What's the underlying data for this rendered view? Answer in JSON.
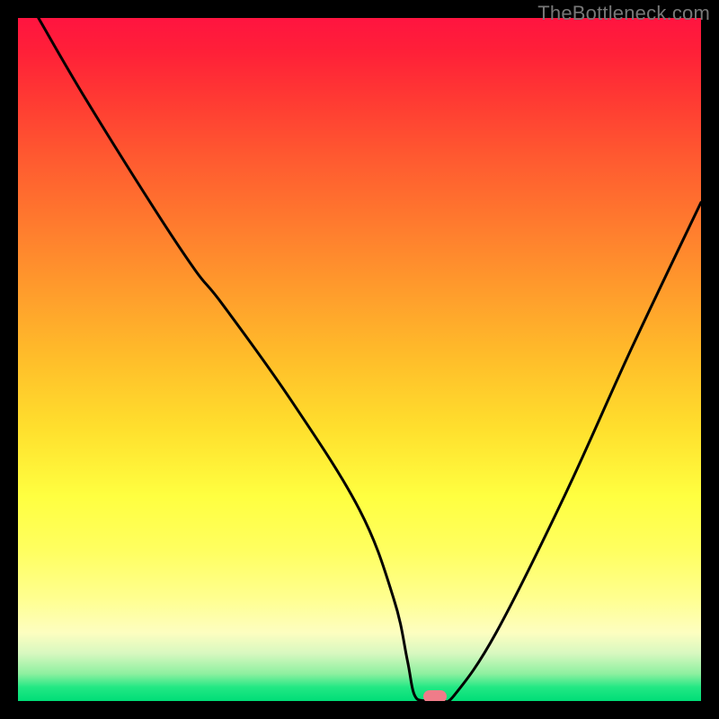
{
  "watermark": "TheBottleneck.com",
  "chart_data": {
    "type": "line",
    "title": "",
    "xlabel": "",
    "ylabel": "",
    "xlim": [
      0,
      100
    ],
    "ylim": [
      0,
      100
    ],
    "grid": false,
    "series": [
      {
        "name": "curve",
        "x": [
          3,
          10,
          20,
          26,
          30,
          40,
          50,
          55,
          57,
          58,
          59.5,
          62,
          64,
          70,
          80,
          90,
          100
        ],
        "y": [
          100,
          88,
          72,
          63,
          58,
          44,
          28,
          15,
          6,
          1,
          0,
          0,
          1,
          10,
          30,
          52,
          73
        ]
      }
    ],
    "marker": {
      "x": 61,
      "y": 0.6
    },
    "background_gradient": {
      "top": "#ff1440",
      "mid": "#ffff40",
      "bottom": "#00dd77"
    }
  }
}
